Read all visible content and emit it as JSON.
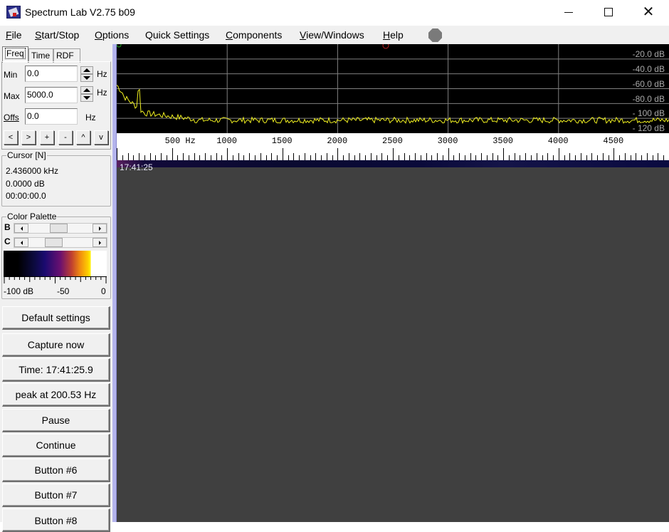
{
  "window": {
    "title": "Spectrum Lab V2.75 b09",
    "controls": [
      "minimize",
      "maximize",
      "close"
    ]
  },
  "menu": [
    {
      "label": "File",
      "accel": "F",
      "rest": "ile"
    },
    {
      "label": "Start/Stop",
      "accel": "S",
      "rest": "tart/Stop"
    },
    {
      "label": "Options",
      "accel": "O",
      "rest": "ptions"
    },
    {
      "label": "Quick Settings",
      "accel": "",
      "rest": "Quick Settings"
    },
    {
      "label": "Components",
      "accel": "C",
      "rest": "omponents"
    },
    {
      "label": "View/Windows",
      "accel": "V",
      "rest": "iew/Windows"
    },
    {
      "label": "Help",
      "accel": "H",
      "rest": "elp"
    }
  ],
  "stop_indicator": {
    "icon": "stop-octagon-icon",
    "color": "#7a7a7a"
  },
  "tabs": [
    {
      "label": "Freq",
      "active": true
    },
    {
      "label": "Time",
      "active": false
    },
    {
      "label": "RDF",
      "active": false
    }
  ],
  "freq_panel": {
    "min_label": "Min",
    "min_value": "0.0",
    "max_label": "Max",
    "max_value": "5000.0",
    "offs_label": "Offs",
    "offs_value": "0.0",
    "unit": "Hz",
    "nav_buttons": [
      "<",
      ">",
      "+",
      "-",
      "^",
      "v"
    ]
  },
  "cursor": {
    "title": "Cursor [N]",
    "frequency": "2.436000 kHz",
    "level": "0.0000 dB",
    "time": "00:00:00.0"
  },
  "color_palette": {
    "title": "Color Palette",
    "brightness_label": "B",
    "contrast_label": "C",
    "brightness_value": 0.45,
    "contrast_value": 0.35,
    "scale_labels": [
      "-100 dB",
      "-50",
      "0"
    ]
  },
  "buttons": [
    "Default settings",
    "Capture now",
    "Time:  17:41:25.9",
    "peak at 200.53 Hz",
    "Pause",
    "Continue",
    "Button #6",
    "Button #7",
    "Button #8"
  ],
  "spectrum": {
    "db_labels": [
      "-20.0 dB",
      "-40.0 dB",
      "-60.0 dB",
      "-80.0 dB",
      "- 100 dB",
      "- 120 dB"
    ],
    "trace_color": "#f0f020",
    "grid_color": "#808080",
    "freq_min_hz": 0,
    "freq_max_hz": 5000,
    "db_top": 0,
    "db_bottom": -120,
    "noise_floor_db": -103,
    "peak_hz": 200.53
  },
  "freq_axis": {
    "labels": [
      "500 Hz",
      "1000",
      "1500",
      "2000",
      "2500",
      "3000",
      "3500",
      "4000",
      "4500"
    ],
    "label_hz": [
      500,
      1000,
      1500,
      2000,
      2500,
      3000,
      3500,
      4000,
      4500
    ]
  },
  "waterfall": {
    "timestamp": "17:41:25"
  }
}
